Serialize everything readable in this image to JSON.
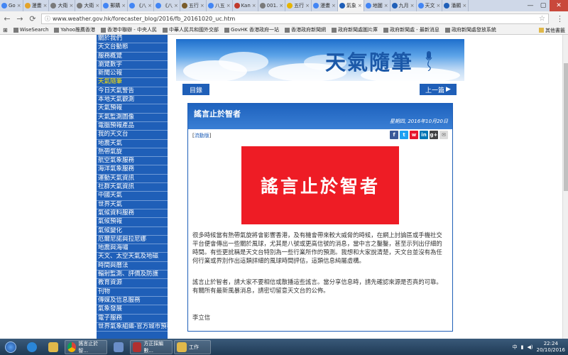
{
  "browser": {
    "tabs": [
      {
        "label": "Go",
        "color": "#4285f4"
      },
      {
        "label": "漫畫",
        "color": "#e3a32a"
      },
      {
        "label": "大衛",
        "color": "#7a7a7a"
      },
      {
        "label": "大衛",
        "color": "#7a7a7a"
      },
      {
        "label": "郵購",
        "color": "#4285f4"
      },
      {
        "label": "《八",
        "color": "#4285f4"
      },
      {
        "label": "《八",
        "color": "#4285f4"
      },
      {
        "label": "五行",
        "color": "#7a5c2a"
      },
      {
        "label": "八五",
        "color": "#4285f4"
      },
      {
        "label": "Kan",
        "color": "#c0392b"
      },
      {
        "label": "001.",
        "color": "#7a7a7a"
      },
      {
        "label": "五行",
        "color": "#e6b400"
      },
      {
        "label": "漫畫",
        "color": "#4285f4"
      },
      {
        "label": "氣象",
        "color": "#1f5fb8",
        "active": true
      },
      {
        "label": "地圖",
        "color": "#4285f4"
      },
      {
        "label": "九月",
        "color": "#1f5fb8"
      },
      {
        "label": "天文",
        "color": "#4285f4"
      },
      {
        "label": "潘顯",
        "color": "#1f5fb8"
      }
    ],
    "url": "www.weather.gov.hk/forecaster_blog/2016/fb_20161020_uc.htm",
    "bookmarks": [
      "WiseSearch",
      "Yahoo推薦香港",
      "香港中聯辦 - 中央人民",
      "中華人民共和國外交部",
      "GovHK 香港政府一站",
      "香港政府新聞網",
      "政府新聞處圖片庫",
      "政府新聞處 - 最新消息",
      "政府新聞處發放系統"
    ],
    "other_bookmarks": "其他書籤"
  },
  "sidebar": {
    "items": [
      "關於我們",
      "天文台動態",
      "服務概覽",
      "瀏覽數字",
      "新聞公報",
      "天氣隨筆",
      "今日天氣警告",
      "本地天氣觀測",
      "天氣預報",
      "天氣監測圖像",
      "電腦預報產品",
      "我的天文台",
      "地震天氣",
      "熱帶氣旋",
      "航空氣象服務",
      "海洋氣象服務",
      "運動天氣資訊",
      "社群天氣資訊",
      "中國天氣",
      "世界天氣",
      "氣候資料服務",
      "氣候預報",
      "氣候變化",
      "厄爾尼諾與拉尼娜",
      "地震與海嘯",
      "天文、太空天氣及地磁",
      "時間與曆法",
      "輻射監測、評價及防護",
      "教育資源",
      "刊物",
      "傳媒及信息服務",
      "氣象發展",
      "電子服務",
      "世界氣象組織-官方城市預報"
    ],
    "active_index": 5
  },
  "page": {
    "banner_title": "天氣隨筆",
    "index_button": "目錄",
    "prev_button": "上一篇",
    "article": {
      "title": "謠言止於智者",
      "date": "星期四, 2016年10月20日",
      "mobile_prefix": "[",
      "mobile_link": "流動版",
      "mobile_suffix": "]",
      "image_text": "謠言止於智者",
      "paragraph1": "很多時候當有熱帶氣旋將會影響香港，及有機會帶來較大威脅的時候，在網上討論區或手機社交平台便會傳出一些關於風球，尤其是八號或更高信號的消息，當中言之鑿鑿，甚至示列出仔細的時間。有些更訛稱是天文台特別為一些行業所作的預測。我想和大家說清楚，天文台並沒有為任何行業或界別作出這類詳細的風球時間評估，這類信息純屬虛構。",
      "paragraph2": "謠言止於智者，請大家不要相信或散播這些謠言。當分享信息時，請先確認來源是否真的可靠。有關所有最新風暴消息，請密切留意天文台的公佈。",
      "author": "李立信"
    }
  },
  "taskbar": {
    "app1": "謠言止於智...",
    "app2": "方正採編數...",
    "app3": "工作",
    "time": "22:24",
    "date": "20/10/2016"
  }
}
